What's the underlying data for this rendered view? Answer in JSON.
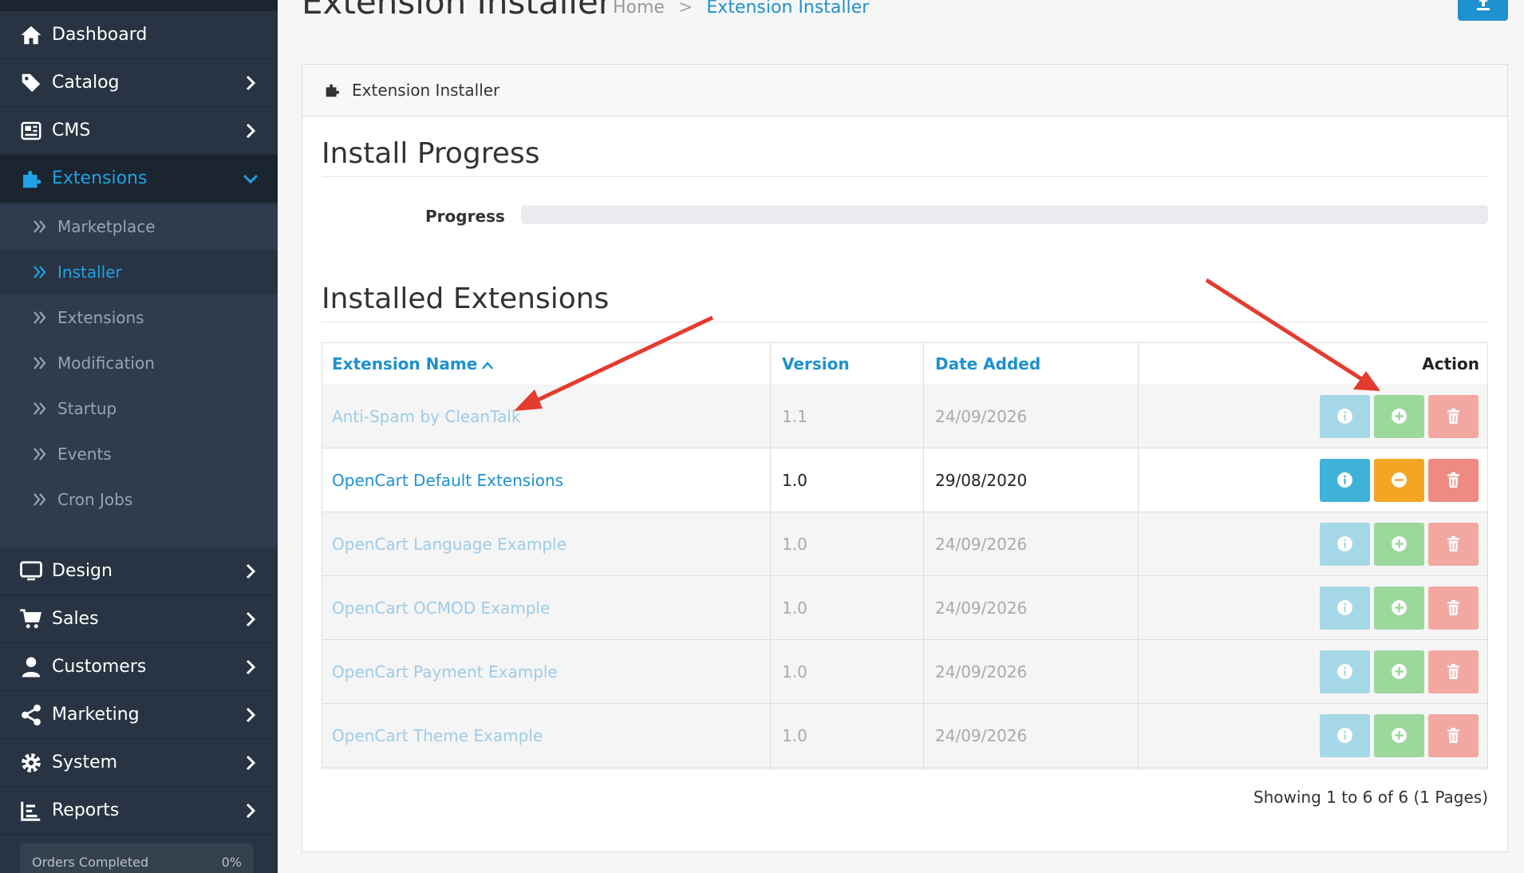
{
  "sidebar": {
    "items": [
      {
        "label": "Dashboard",
        "icon": "home-icon"
      },
      {
        "label": "Catalog",
        "icon": "tag-icon"
      },
      {
        "label": "CMS",
        "icon": "newspaper-icon"
      },
      {
        "label": "Extensions",
        "icon": "puzzle-icon"
      },
      {
        "label": "Design",
        "icon": "monitor-icon"
      },
      {
        "label": "Sales",
        "icon": "cart-icon"
      },
      {
        "label": "Customers",
        "icon": "user-icon"
      },
      {
        "label": "Marketing",
        "icon": "share-icon"
      },
      {
        "label": "System",
        "icon": "gear-icon"
      },
      {
        "label": "Reports",
        "icon": "bar-chart-icon"
      }
    ],
    "extensions_sub": [
      {
        "label": "Marketplace"
      },
      {
        "label": "Installer"
      },
      {
        "label": "Extensions"
      },
      {
        "label": "Modification"
      },
      {
        "label": "Startup"
      },
      {
        "label": "Events"
      },
      {
        "label": "Cron Jobs"
      }
    ],
    "orders_widget": {
      "label": "Orders Completed",
      "value": "0%"
    }
  },
  "header": {
    "title": "Extension Installer",
    "breadcrumb": {
      "home": "Home",
      "separator": ">",
      "current": "Extension Installer"
    }
  },
  "card": {
    "title": "Extension Installer",
    "install_progress": {
      "heading": "Install Progress",
      "label": "Progress",
      "value": 0
    },
    "installed": {
      "heading": "Installed Extensions",
      "columns": {
        "name": "Extension Name",
        "version": "Version",
        "date": "Date Added",
        "action": "Action"
      },
      "rows": [
        {
          "name": "Anti-Spam by CleanTalk",
          "version": "1.1",
          "date": "24/09/2026",
          "installed": false
        },
        {
          "name": "OpenCart Default Extensions",
          "version": "1.0",
          "date": "29/08/2020",
          "installed": true
        },
        {
          "name": "OpenCart Language Example",
          "version": "1.0",
          "date": "24/09/2026",
          "installed": false
        },
        {
          "name": "OpenCart OCMOD Example",
          "version": "1.0",
          "date": "24/09/2026",
          "installed": false
        },
        {
          "name": "OpenCart Payment Example",
          "version": "1.0",
          "date": "24/09/2026",
          "installed": false
        },
        {
          "name": "OpenCart Theme Example",
          "version": "1.0",
          "date": "24/09/2026",
          "installed": false
        }
      ],
      "pagination": "Showing 1 to 6 of 6 (1 Pages)"
    }
  },
  "colors": {
    "sidebar_bg": "#283443",
    "accent": "#1e91cf",
    "info": "#3fb2d9",
    "success": "#9cd79c",
    "warning": "#f4a523",
    "danger": "#ee8a82",
    "annotation_arrow": "#e53b2f"
  }
}
